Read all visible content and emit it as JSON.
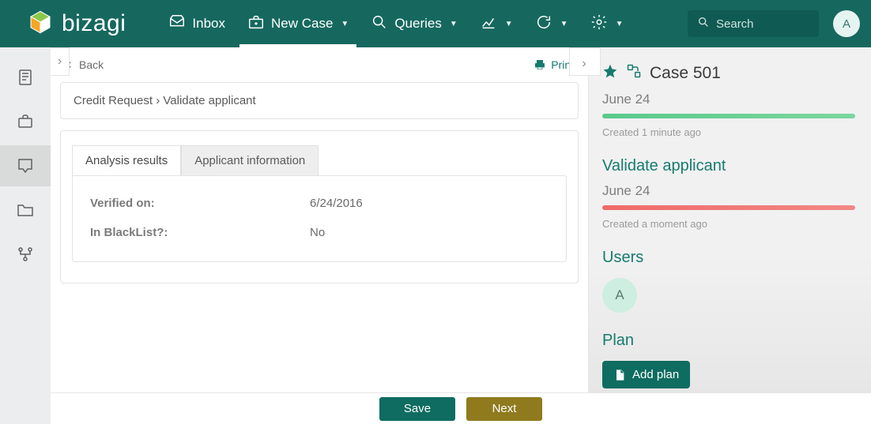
{
  "brand": "bizagi",
  "nav": {
    "inbox": "Inbox",
    "newcase": "New Case",
    "queries": "Queries"
  },
  "search": {
    "placeholder": "Search"
  },
  "user_initial": "A",
  "center": {
    "back": "Back",
    "print": "Print",
    "breadcrumb": "Credit Request › Validate applicant",
    "tabs": {
      "analysis": "Analysis results",
      "applicant": "Applicant information"
    },
    "fields": {
      "verified_label": "Verified on:",
      "verified_value": "6/24/2016",
      "blacklist_label": "In BlackList?:",
      "blacklist_value": "No"
    }
  },
  "right": {
    "case_label": "Case 501",
    "date1": "June 24",
    "created1": "Created 1 minute ago",
    "task_title": "Validate applicant",
    "date2": "June 24",
    "created2": "Created a moment ago",
    "users_title": "Users",
    "user_initial": "A",
    "plan_title": "Plan",
    "add_plan": "Add plan"
  },
  "buttons": {
    "save": "Save",
    "next": "Next"
  }
}
